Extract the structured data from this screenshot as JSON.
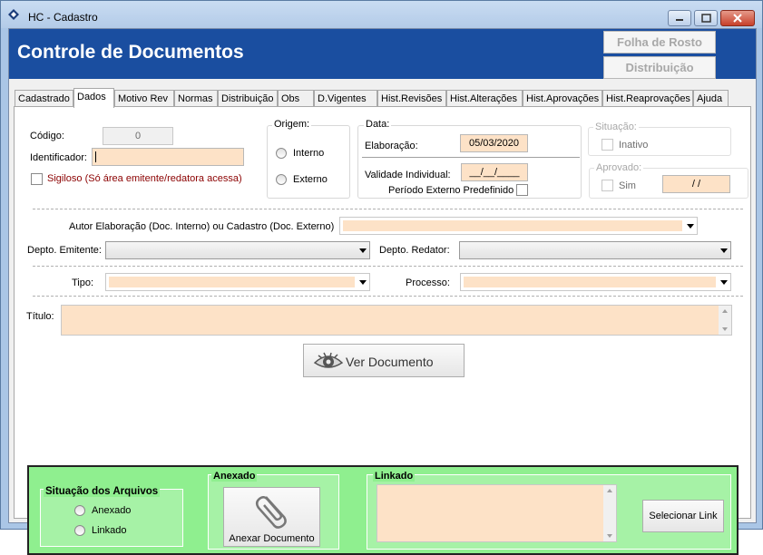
{
  "window": {
    "title": "HC - Cadastro"
  },
  "header": {
    "title": "Controle de Documentos",
    "folha_button": "Folha de Rosto",
    "distribuicao_button": "Distribuição"
  },
  "tabs": [
    "Cadastrado",
    "Dados",
    "Motivo Rev",
    "Normas",
    "Distribuição",
    "Obs",
    "D.Vigentes",
    "Hist.Revisões",
    "Hist.Alterações",
    "Hist.Aprovações",
    "Hist.Reaprovações",
    "Ajuda"
  ],
  "active_tab": "Dados",
  "form": {
    "codigo_label": "Código:",
    "codigo_value": "0",
    "identificador_label": "Identificador:",
    "identificador_value": "",
    "sigiloso_label": "Sigiloso (Só área emitente/redatora acessa)",
    "origem_title": "Origem:",
    "origem_interno": "Interno",
    "origem_externo": "Externo",
    "data_title": "Data:",
    "elaboracao_label": "Elaboração:",
    "elaboracao_value": "05/03/2020",
    "validade_label": "Validade Individual:",
    "validade_value": "__/__/____",
    "periodo_label": "Período Externo Predefinido",
    "situacao_title": "Situação:",
    "inativo_label": "Inativo",
    "aprovado_title": "Aprovado:",
    "sim_label": "Sim",
    "aprovado_value": "/ /",
    "autor_label": "Autor Elaboração (Doc. Interno) ou  Cadastro (Doc. Externo)",
    "depto_emitente_label": "Depto. Emitente:",
    "depto_redator_label": "Depto. Redator:",
    "tipo_label": "Tipo:",
    "processo_label": "Processo:",
    "titulo_label": "Título:",
    "ver_documento": "Ver Documento"
  },
  "arquivos": {
    "situacao_title": "Situação dos Arquivos",
    "anexado_option": "Anexado",
    "linkado_option": "Linkado",
    "anexado_title": "Anexado",
    "anexar_button": "Anexar Documento",
    "linkado_title": "Linkado",
    "selecionar_link": "Selecionar Link"
  },
  "colors": {
    "header_blue": "#1a4ea0",
    "field_peach": "#fde2c7",
    "green_panel": "#8fef8f",
    "sigiloso_red": "#8b0000"
  }
}
